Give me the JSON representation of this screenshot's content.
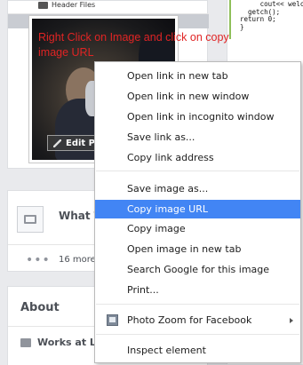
{
  "header": {
    "file_label": "Header Files"
  },
  "annotation": "Right Click on Image and click on copy image URL",
  "profile": {
    "edit_label": "Edit Pro"
  },
  "code": {
    "lines": [
      "     cout<< welco",
      "  getch();",
      "return 0;",
      "}"
    ]
  },
  "what_card": {
    "title": "What T",
    "more_text": "16 more",
    "dots": "•••"
  },
  "about_card": {
    "title": "About",
    "work_text": "Works at Le"
  },
  "context_menu": {
    "items": [
      "Open link in new tab",
      "Open link in new window",
      "Open link in incognito window",
      "Save link as...",
      "Copy link address",
      "Save image as...",
      "Copy image URL",
      "Copy image",
      "Open image in new tab",
      "Search Google for this image",
      "Print...",
      "Photo Zoom for Facebook",
      "Inspect element"
    ],
    "highlighted": "Copy image URL",
    "highlight_color": "#4285f4"
  },
  "colors": {
    "annotation": "#e02424",
    "page_bg": "#e9eaed"
  }
}
